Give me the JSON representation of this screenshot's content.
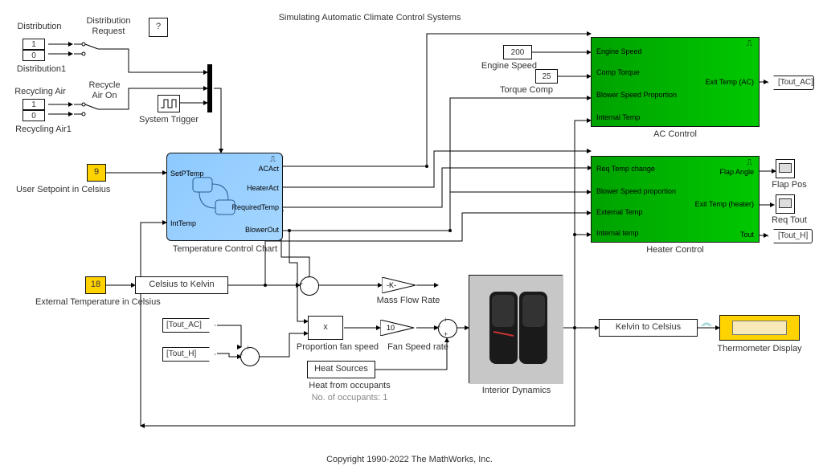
{
  "title": "Simulating Automatic Climate Control Systems",
  "copyright": "Copyright 1990-2022 The MathWorks, Inc.",
  "help": "?",
  "distribution": {
    "label": "Distribution",
    "request": "Distribution\nRequest",
    "block1": "Distribution1",
    "vals": [
      "1",
      "0"
    ]
  },
  "recycling": {
    "label": "Recycling Air",
    "airon": "Recycle\nAir On",
    "block1": "Recycling Air1",
    "vals": [
      "1",
      "0"
    ]
  },
  "system_trigger": "System Trigger",
  "user_setpoint": {
    "value": "9",
    "label": "User Setpoint in Celsius"
  },
  "ext_temp": {
    "value": "18",
    "label": "External Temperature in Celsius"
  },
  "tcc": {
    "label": "Temperature Control Chart",
    "ports": {
      "setptemp": "SetPTemp",
      "inttemp": "IntTemp",
      "acact": "ACAct",
      "heateract": "HeaterAct",
      "reqtemp": "RequiredTemp",
      "blowerout": "BlowerOut"
    }
  },
  "c2k": "Celsius to Kelvin",
  "k2c": "Kelvin to Celsius",
  "tags": {
    "tout_ac": "[Tout_AC]",
    "tout_h": "[Tout_H]"
  },
  "engine_speed": {
    "label": "Engine Speed",
    "value": "200"
  },
  "torque_comp": {
    "label": "Torque Comp",
    "value": "25"
  },
  "ac": {
    "label": "AC Control",
    "ports": {
      "engine_speed": "Engine Speed",
      "comp_torque": "Comp Torque",
      "blower_speed": "Blower Speed Proportion",
      "internal_temp": "Internal Temp",
      "exit_temp": "Exit Temp (AC)"
    }
  },
  "heater": {
    "label": "Heater Control",
    "ports": {
      "req_temp": "Req Temp change",
      "blower_speed": "Blower Speed proportion",
      "ext_temp": "External Temp",
      "int_temp": "Internal temp",
      "flap_angle": "Flap Angle",
      "exit_temp": "Exit Temp (heater)",
      "tout": "Tout"
    }
  },
  "mass_flow": {
    "gain": "-K-",
    "label": "Mass Flow Rate"
  },
  "prop_fan": {
    "op": "x",
    "label": "Proportion fan speed"
  },
  "fan_speed": {
    "gain": "10",
    "label": "Fan Speed rate"
  },
  "heat_sources": {
    "name": "Heat Sources",
    "label": "Heat from occupants",
    "occupants": "No. of occupants: 1"
  },
  "interior_dynamics": "Interior Dynamics",
  "thermometer": "Thermometer Display",
  "scopes": {
    "flap": "Flap Pos",
    "req": "Req Tout"
  }
}
